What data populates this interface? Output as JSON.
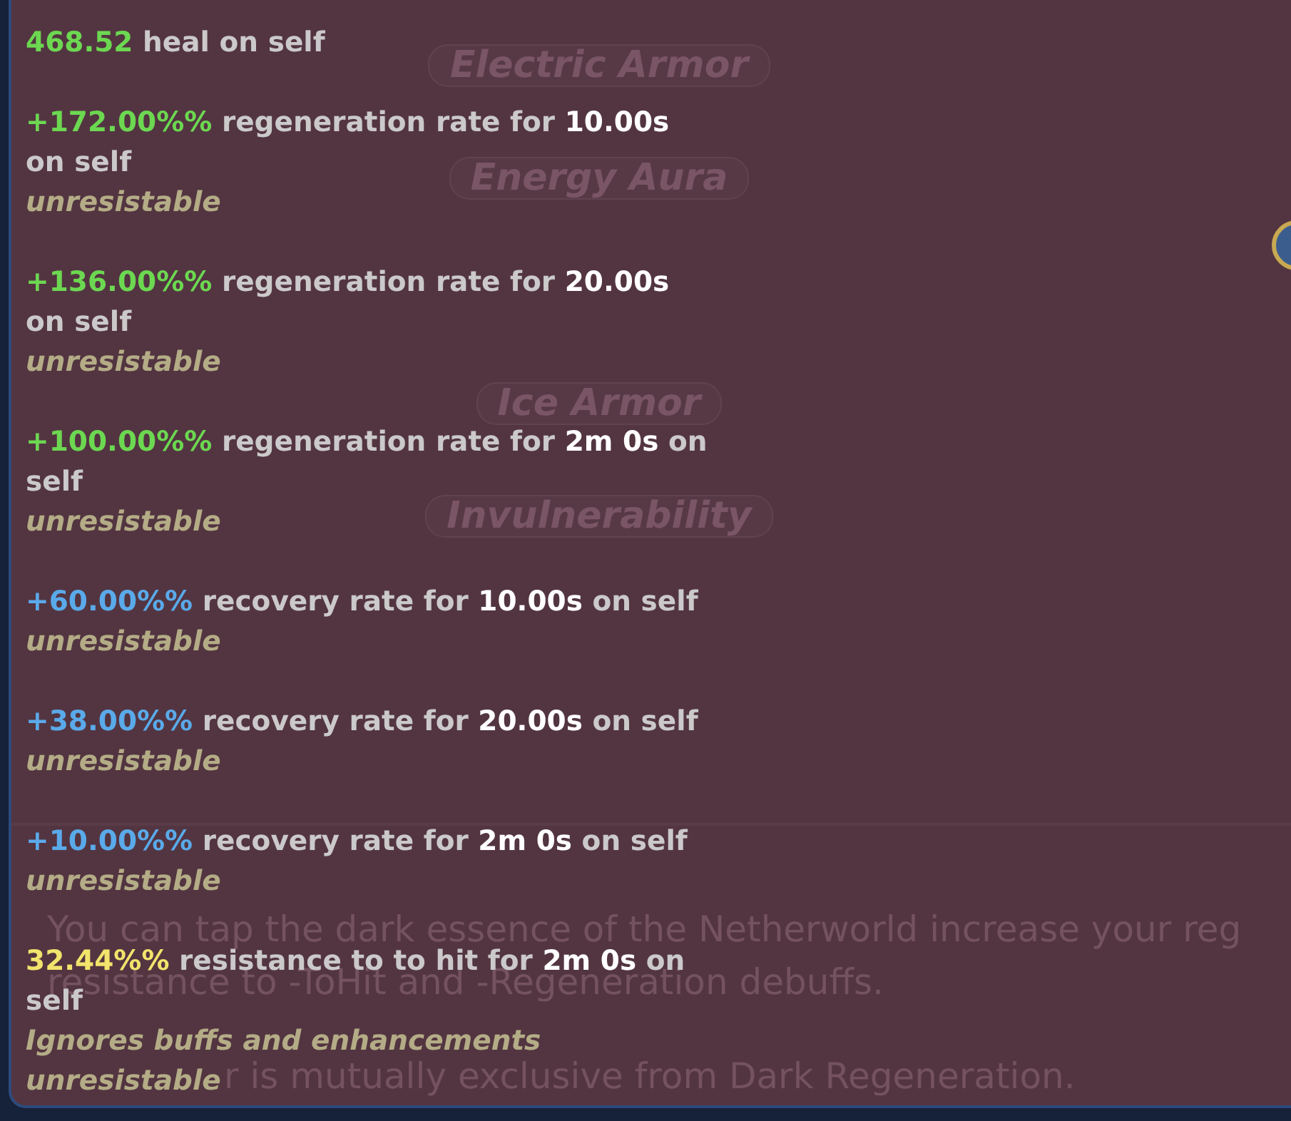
{
  "power_list": {
    "buttons": [
      {
        "label": "Electric Armor",
        "obscured": false
      },
      {
        "label": "Energy Aura",
        "obscured": false
      },
      {
        "obscured": true
      },
      {
        "label": "Ice Armor",
        "obscured": false
      },
      {
        "label": "Invulnerability",
        "obscured": false
      }
    ]
  },
  "power_info": {
    "description": [
      "You can tap the dark essence of the Netherworld increase your reg",
      "resistance to -ToHit and -Regeneration debuffs."
    ],
    "note": "r is mutually exclusive from Dark Regeneration."
  },
  "tooltip": {
    "effects": [
      {
        "value": "468.52",
        "color": "#6cd851",
        "text": "heal on self"
      },
      {
        "value": "+172.00%%",
        "color": "#6cd851",
        "text": "regeneration rate for",
        "duration": "10.00s",
        "continued": "on self",
        "notes": [
          "unresistable"
        ]
      },
      {
        "value": "+136.00%%",
        "color": "#6cd851",
        "text": "regeneration rate for",
        "duration": "20.00s",
        "continued": "on self",
        "notes": [
          "unresistable"
        ]
      },
      {
        "value": "+100.00%%",
        "color": "#6cd851",
        "text": "regeneration rate for",
        "duration": "2m 0s",
        "target": "on",
        "continued": "self",
        "notes": [
          "unresistable"
        ]
      },
      {
        "value": "+60.00%%",
        "color": "#5aaaea",
        "text": "recovery rate for",
        "duration": "10.00s",
        "target": "on self",
        "notes": [
          "unresistable"
        ]
      },
      {
        "value": "+38.00%%",
        "color": "#5aaaea",
        "text": "recovery rate for",
        "duration": "20.00s",
        "target": "on self",
        "notes": [
          "unresistable"
        ]
      },
      {
        "value": "+10.00%%",
        "color": "#5aaaea",
        "text": "recovery rate for",
        "duration": "2m 0s",
        "target": "on self",
        "notes": [
          "unresistable"
        ]
      },
      {
        "value": "32.44%%",
        "color": "#f2e46c",
        "text": "resistance to to hit for",
        "duration": "2m 0s",
        "target": "on",
        "continued": "self",
        "notes": [
          "Ignores buffs and enhancements",
          "unresistable"
        ]
      }
    ]
  }
}
